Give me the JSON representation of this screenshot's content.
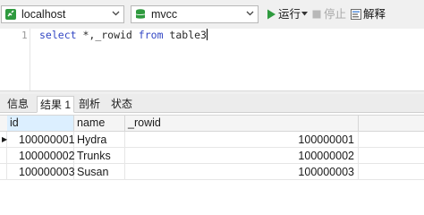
{
  "toolbar": {
    "connection": {
      "label": "localhost",
      "icon": "connection-icon",
      "icon_color": "#2e9a3e"
    },
    "database": {
      "label": "mvcc",
      "icon": "database-icon",
      "icon_color": "#2e9a3e"
    },
    "run": {
      "label": "运行",
      "icon": "play-icon",
      "color": "#2e9a3e"
    },
    "stop": {
      "label": "停止",
      "icon": "stop-icon"
    },
    "explain": {
      "label": "解释",
      "icon": "explain-icon"
    }
  },
  "editor": {
    "line_number": "1",
    "query": {
      "kw1": "select",
      "cols": " *,_rowid ",
      "kw2": "from",
      "table": " table3"
    }
  },
  "result_tabs": [
    {
      "label": "信息",
      "active": false
    },
    {
      "label": "结果 1",
      "active": true
    },
    {
      "label": "剖析",
      "active": false
    },
    {
      "label": "状态",
      "active": false
    }
  ],
  "grid": {
    "columns": [
      "id",
      "name",
      "_rowid"
    ],
    "rows": [
      {
        "id": "100000001",
        "name": "Hydra",
        "rowid": "100000001",
        "current": true
      },
      {
        "id": "100000002",
        "name": "Trunks",
        "rowid": "100000002",
        "current": false
      },
      {
        "id": "100000003",
        "name": "Susan",
        "rowid": "100000003",
        "current": false
      }
    ]
  }
}
